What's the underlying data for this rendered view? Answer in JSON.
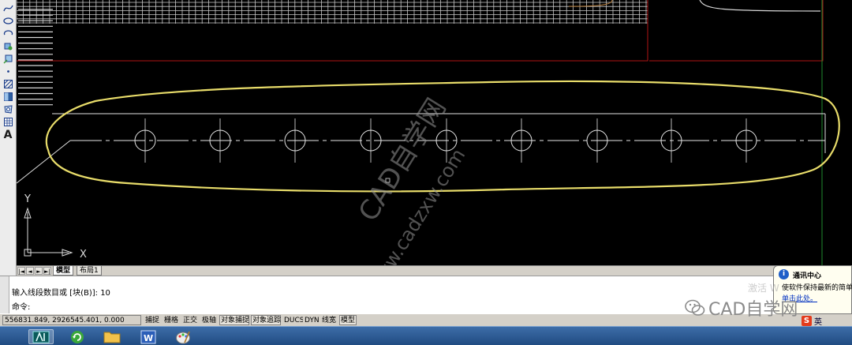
{
  "toolbar": {
    "items": [
      "spline-icon",
      "ellipse-icon",
      "ellipse-arc-icon",
      "insert-block-icon",
      "make-block-icon",
      "point-icon",
      "hatch-icon",
      "gradient-icon",
      "region-icon",
      "table-icon",
      "multiline-text-icon"
    ],
    "text_tool_label": "A"
  },
  "viewport": {
    "ucs_y_label": "Y",
    "ucs_x_label": "X",
    "colors": {
      "grid": "#c8c8c8",
      "boundary": "#b01414",
      "selection_outline": "#e8dc6a",
      "centerline": "#e6e6e6",
      "green_line": "#1f8a2e"
    }
  },
  "layout_tabs": {
    "nav": [
      "|◄",
      "◄",
      "►",
      "►|"
    ],
    "tabs": [
      "模型",
      "布局1"
    ]
  },
  "command": {
    "history_line": "输入线段数目或 [块(B)]: 10",
    "prompt_line": "命令:"
  },
  "status_bar": {
    "coordinates": "556831.849, 2926545.401, 0.000",
    "toggles": [
      {
        "label": "捕捉",
        "on": false
      },
      {
        "label": "栅格",
        "on": false
      },
      {
        "label": "正交",
        "on": false
      },
      {
        "label": "极轴",
        "on": false
      },
      {
        "label": "对象捕捉",
        "on": true
      },
      {
        "label": "对象追踪",
        "on": true
      },
      {
        "label": "DUCS",
        "on": false
      },
      {
        "label": "DYN",
        "on": false
      },
      {
        "label": "线宽",
        "on": false
      },
      {
        "label": "模型",
        "on": true
      }
    ]
  },
  "notification": {
    "title": "通讯中心",
    "body": "使软件保持最新的简单方",
    "link": "单击此处。"
  },
  "watermark": {
    "diagonal_main": "CAD自学网",
    "diagonal_url": "www.cadzxw.com",
    "logo_text": "CAD自学网",
    "activation": "激活 W"
  },
  "ime": {
    "mark": "S",
    "label": "英"
  },
  "taskbar": {
    "apps": [
      "autocad-icon",
      "refresh-icon",
      "folder-icon",
      "word-icon",
      "paint-icon"
    ]
  }
}
